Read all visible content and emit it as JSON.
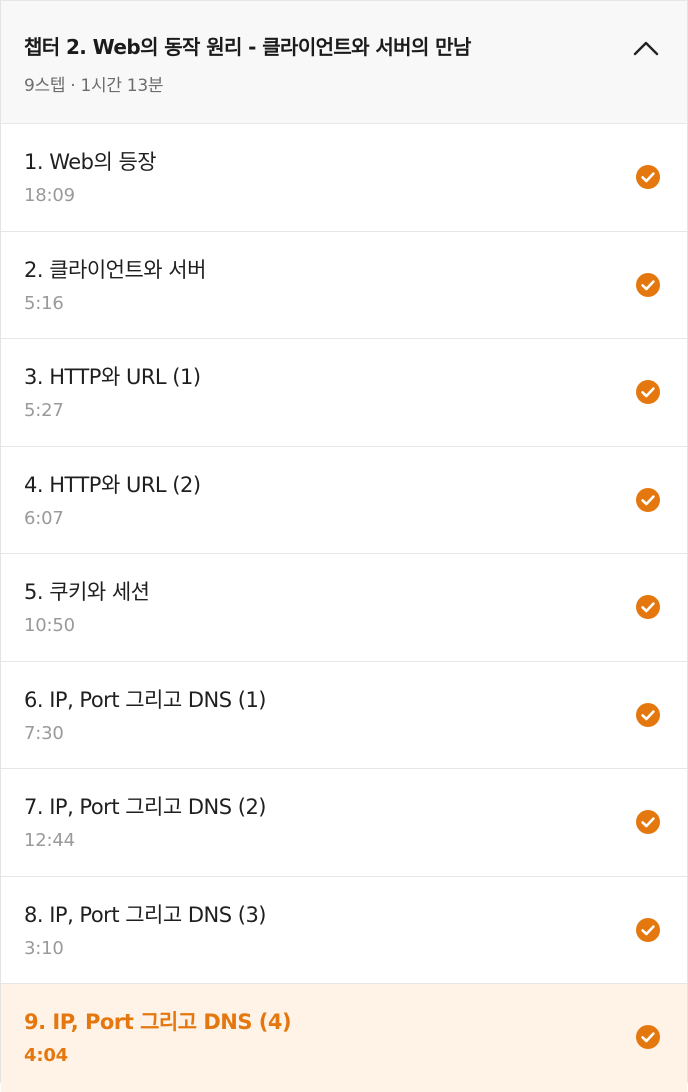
{
  "accent_color": "#e4780f",
  "chapter": {
    "title": "챕터 2. Web의 동작 원리 - 클라이언트와 서버의 만남",
    "meta": "9스텝 · 1시간 13분",
    "toggle_icon": "chevron-up-icon"
  },
  "lessons": [
    {
      "title": "1. Web의 등장",
      "duration": "18:09",
      "completed": true,
      "active": false
    },
    {
      "title": "2. 클라이언트와 서버",
      "duration": "5:16",
      "completed": true,
      "active": false
    },
    {
      "title": "3. HTTP와 URL (1)",
      "duration": "5:27",
      "completed": true,
      "active": false
    },
    {
      "title": "4. HTTP와 URL (2)",
      "duration": "6:07",
      "completed": true,
      "active": false
    },
    {
      "title": "5. 쿠키와 세션",
      "duration": "10:50",
      "completed": true,
      "active": false
    },
    {
      "title": "6. IP, Port 그리고 DNS (1)",
      "duration": "7:30",
      "completed": true,
      "active": false
    },
    {
      "title": "7. IP, Port 그리고 DNS (2)",
      "duration": "12:44",
      "completed": true,
      "active": false
    },
    {
      "title": "8. IP, Port 그리고 DNS (3)",
      "duration": "3:10",
      "completed": true,
      "active": false
    },
    {
      "title": "9. IP, Port 그리고 DNS (4)",
      "duration": "4:04",
      "completed": true,
      "active": true
    }
  ]
}
